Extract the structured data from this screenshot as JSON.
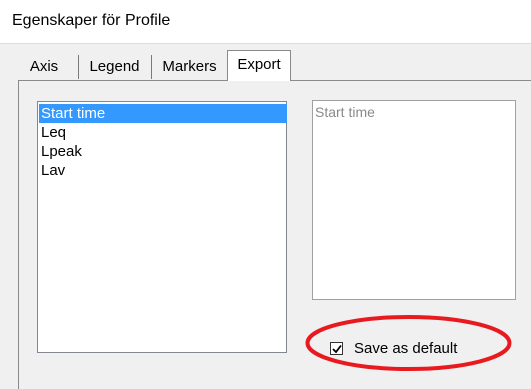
{
  "window": {
    "title": "Egenskaper för Profile"
  },
  "tabs": [
    {
      "label": "Axis",
      "active": false
    },
    {
      "label": "Legend",
      "active": false
    },
    {
      "label": "Markers",
      "active": false
    },
    {
      "label": "Export",
      "active": true
    }
  ],
  "export": {
    "fields": [
      "Start time",
      "Leq",
      "Lpeak",
      "Lav"
    ],
    "selected_field": "Start time",
    "preview_text": "Start time",
    "save_default": {
      "label": "Save as default",
      "checked": true
    }
  },
  "colors": {
    "selection": "#3399ff",
    "highlight_ring": "#e8191f"
  }
}
